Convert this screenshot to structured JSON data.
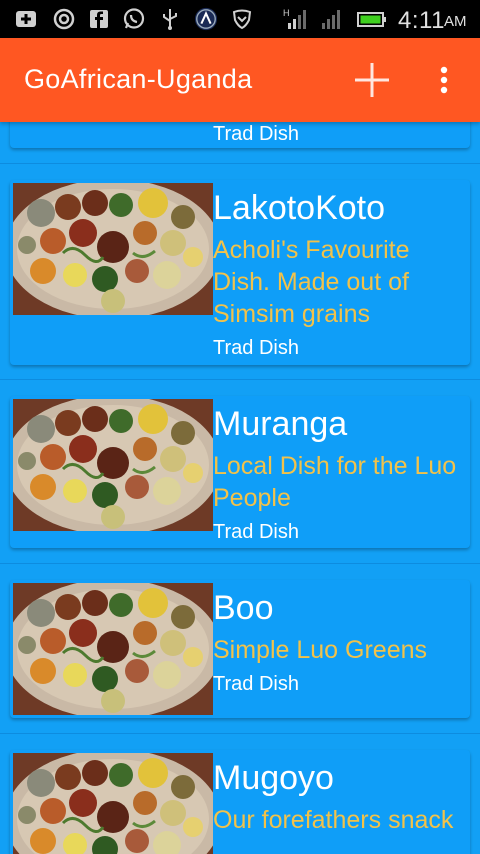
{
  "status_bar": {
    "time": "4:11",
    "ampm": "AM",
    "network_label": "H",
    "icons": [
      "add-notification-icon",
      "sync-icon",
      "facebook-icon",
      "whatsapp-icon",
      "usb-icon",
      "vpn-icon",
      "shield-icon",
      "signal-icon",
      "signal-icon-2",
      "battery-icon"
    ]
  },
  "app_bar": {
    "title": "GoAfrican-Uganda",
    "add_icon": "plus-icon",
    "overflow_icon": "more-vert-icon",
    "color": "#ff5722"
  },
  "list": {
    "background": "#12a0f5",
    "items": [
      {
        "name": "",
        "description": "",
        "category": "Trad Dish"
      },
      {
        "name": "LakotoKoto",
        "description": "Acholi's Favourite Dish. Made out of Simsim grains",
        "category": "Trad Dish"
      },
      {
        "name": "Muranga",
        "description": "Local Dish for the Luo People",
        "category": "Trad Dish"
      },
      {
        "name": "Boo",
        "description": "Simple Luo Greens",
        "category": "Trad Dish"
      },
      {
        "name": "Mugoyo",
        "description": "Our forefathers snack",
        "category": ""
      }
    ]
  },
  "colors": {
    "description_text": "#f2c24a",
    "title_text": "#ffffff"
  }
}
